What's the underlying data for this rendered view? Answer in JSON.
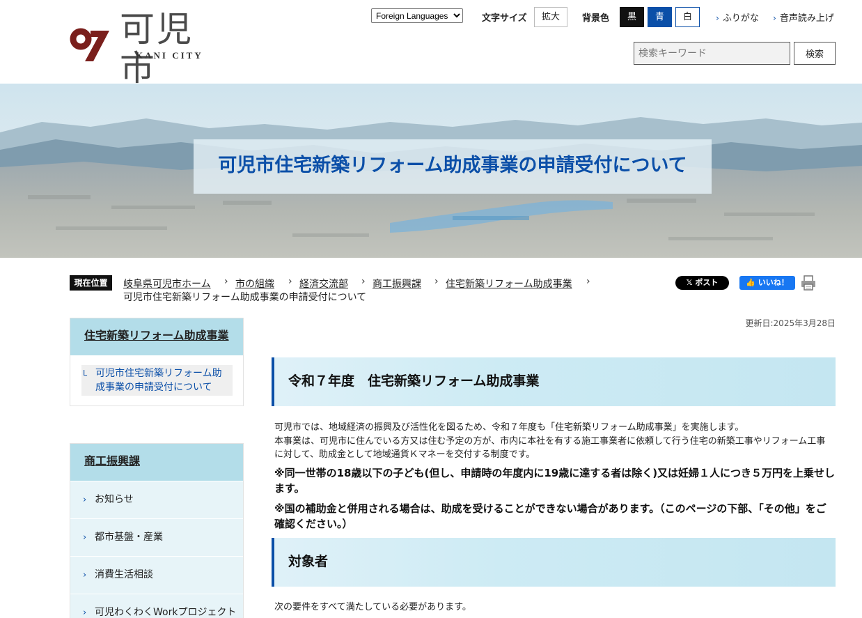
{
  "header": {
    "logo_title": "可児市",
    "logo_sub": "KANI CITY",
    "language_select": "Foreign Languages",
    "font_size_label": "文字サイズ",
    "font_size_enlarge": "拡大",
    "bg_color_label": "背景色",
    "bg_black": "黒",
    "bg_blue": "青",
    "bg_white": "白",
    "furigana": "ふりがな",
    "read_aloud": "音声読み上げ",
    "search_placeholder": "検索キーワード",
    "search_button": "検索"
  },
  "hero": {
    "title": "可児市住宅新築リフォーム助成事業の申請受付について"
  },
  "breadcrumb": {
    "label": "現在位置",
    "items": [
      "岐阜県可児市ホーム",
      "市の組織",
      "経済交流部",
      "商工振興課",
      "住宅新築リフォーム助成事業"
    ],
    "separator": "›",
    "current": "可児市住宅新築リフォーム助成事業の申請受付について"
  },
  "share": {
    "x_post": "𝕏 ポスト",
    "fb_like": "👍 いいね！"
  },
  "sidebar": {
    "box1_title": "住宅新築リフォーム助成事業",
    "box1_sub_mark": "L",
    "box1_sub": "可児市住宅新築リフォーム助成事業の申請受付について",
    "box2_title": "商工振興課",
    "box2_items": [
      "お知らせ",
      "都市基盤・産業",
      "消費生活相談",
      "可児わくわくWorkプロジェクト"
    ]
  },
  "main": {
    "updated": "更新日:2025年3月28日",
    "section1_title": "令和７年度　住宅新築リフォーム助成事業",
    "intro_line1": "可児市では、地域経済の振興及び活性化を図るため、令和７年度も「住宅新築リフォーム助成事業」を実施します。",
    "intro_line2": "本事業は、可児市に住んでいる方又は住む予定の方が、市内に本社を有する施工事業者に依頼して行う住宅の新築工事やリフォーム工事に対して、助成金として地域通貨Ｋマネーを交付する制度です。",
    "note1": "※同一世帯の18歳以下の子ども(但し、申請時の年度内に19歳に達する者は除く)又は妊婦１人につき５万円を上乗せします。",
    "note2": "※国の補助金と併用される場合は、助成を受けることができない場合があります。（このページの下部、「その他」をご確認ください。）",
    "section2_title": "対象者",
    "section2_text": "次の要件をすべて満たしている必要があります。"
  },
  "colors": {
    "brand_blue": "#0b4fa8",
    "logo_red": "#7a1f1c",
    "sidebar_head_bg": "#b3dde9",
    "sidebar_item_bg": "#e7f4f8"
  }
}
